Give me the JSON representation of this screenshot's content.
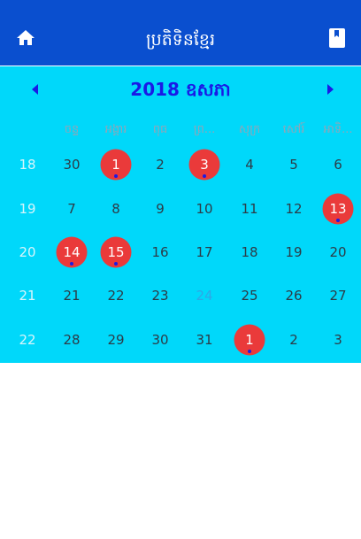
{
  "app_bar": {
    "title": "ប្រតិទិនខ្មែរ",
    "home_icon": "home-icon",
    "book_icon": "book-icon",
    "background": "#0a4fcf"
  },
  "calendar": {
    "background": "#00d8fa",
    "month_title": "2018 ឧសភា",
    "prev_icon": "triangle-left-icon",
    "next_icon": "triangle-right-icon",
    "weekdays": [
      "ចន្ទ",
      "អង្គារ",
      "ពុធ",
      "ព្រ...",
      "សុក្រ",
      "សៅរ៍",
      "អាទិ..."
    ],
    "holiday_color": "#ea3a3a",
    "today_color": "#2fa6e6",
    "weeks": [
      {
        "week": "18",
        "days": [
          {
            "d": "30"
          },
          {
            "d": "1",
            "holiday": true
          },
          {
            "d": "2"
          },
          {
            "d": "3",
            "holiday": true
          },
          {
            "d": "4"
          },
          {
            "d": "5"
          },
          {
            "d": "6"
          }
        ]
      },
      {
        "week": "19",
        "days": [
          {
            "d": "7"
          },
          {
            "d": "8"
          },
          {
            "d": "9"
          },
          {
            "d": "10"
          },
          {
            "d": "11"
          },
          {
            "d": "12"
          },
          {
            "d": "13",
            "holiday": true
          }
        ]
      },
      {
        "week": "20",
        "days": [
          {
            "d": "14",
            "holiday": true
          },
          {
            "d": "15",
            "holiday": true
          },
          {
            "d": "16"
          },
          {
            "d": "17"
          },
          {
            "d": "18"
          },
          {
            "d": "19"
          },
          {
            "d": "20"
          }
        ]
      },
      {
        "week": "21",
        "days": [
          {
            "d": "21"
          },
          {
            "d": "22"
          },
          {
            "d": "23"
          },
          {
            "d": "24",
            "today": true
          },
          {
            "d": "25"
          },
          {
            "d": "26"
          },
          {
            "d": "27"
          }
        ]
      },
      {
        "week": "22",
        "days": [
          {
            "d": "28"
          },
          {
            "d": "29"
          },
          {
            "d": "30"
          },
          {
            "d": "31"
          },
          {
            "d": "1",
            "holiday": true
          },
          {
            "d": "2"
          },
          {
            "d": "3"
          }
        ]
      }
    ]
  }
}
